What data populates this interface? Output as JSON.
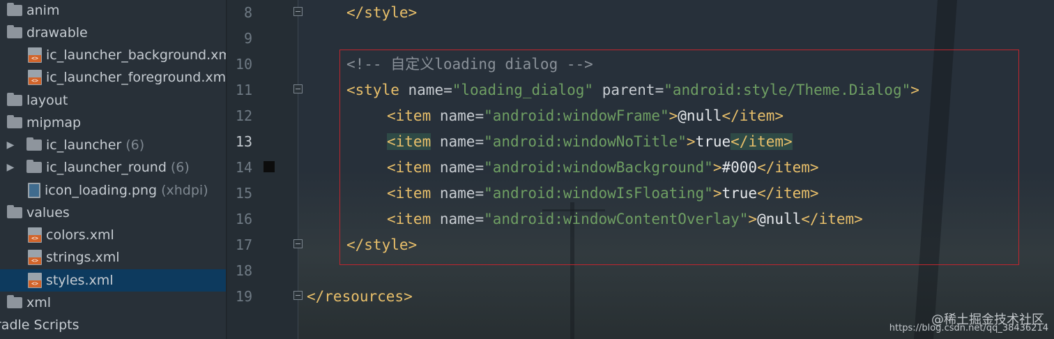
{
  "tree": {
    "items": [
      {
        "label": "anim",
        "type": "folder"
      },
      {
        "label": "drawable",
        "type": "folder"
      },
      {
        "label": "ic_launcher_background.xml",
        "type": "xml"
      },
      {
        "label": "ic_launcher_foreground.xml",
        "type": "xml"
      },
      {
        "label": "layout",
        "type": "folder"
      },
      {
        "label": "mipmap",
        "type": "folder"
      },
      {
        "label": "ic_launcher",
        "suffix": "(6)",
        "type": "folder"
      },
      {
        "label": "ic_launcher_round",
        "suffix": "(6)",
        "type": "folder"
      },
      {
        "label": "icon_loading.png",
        "suffix": "(xhdpi)",
        "type": "image"
      },
      {
        "label": "values",
        "type": "folder"
      },
      {
        "label": "colors.xml",
        "type": "xml"
      },
      {
        "label": "strings.xml",
        "type": "xml"
      },
      {
        "label": "styles.xml",
        "type": "xml",
        "selected": true
      },
      {
        "label": "xml",
        "type": "folder"
      },
      {
        "label": "radle Scripts",
        "type": "group"
      }
    ]
  },
  "editor": {
    "line_numbers": [
      "8",
      "9",
      "10",
      "11",
      "12",
      "13",
      "14",
      "15",
      "16",
      "17",
      "18",
      "19"
    ],
    "current_line": "13",
    "lines": {
      "l8": {
        "open": "</style>"
      },
      "l10": {
        "comment": "<!-- 自定义loading dialog -->"
      },
      "l11": {
        "open": "<style",
        "attr1": "name",
        "eq1": "=",
        "val1": "\"loading_dialog\"",
        "attr2": "parent",
        "eq2": "=",
        "val2": "\"android:style/Theme.Dialog\"",
        "close": ">"
      },
      "l12": {
        "open": "<item",
        "attr": "name",
        "eq": "=",
        "val": "\"android:windowFrame\"",
        "gt": ">",
        "text": "@null",
        "end": "</item>"
      },
      "l13": {
        "open": "<item",
        "attr": "name",
        "eq": "=",
        "val": "\"android:windowNoTitle\"",
        "gt": ">",
        "text": "true",
        "end": "</item>"
      },
      "l14": {
        "open": "<item",
        "attr": "name",
        "eq": "=",
        "val": "\"android:windowBackground\"",
        "gt": ">",
        "text": "#000",
        "end": "</item>"
      },
      "l15": {
        "open": "<item",
        "attr": "name",
        "eq": "=",
        "val": "\"android:windowIsFloating\"",
        "gt": ">",
        "text": "true",
        "end": "</item>"
      },
      "l16": {
        "open": "<item",
        "attr": "name",
        "eq": "=",
        "val": "\"android:windowContentOverlay\"",
        "gt": ">",
        "text": "@null",
        "end": "</item>"
      },
      "l17": {
        "open": "</style>"
      },
      "l19": {
        "open": "</resources>"
      }
    }
  },
  "watermark": {
    "line1": "@稀土掘金技术社区",
    "line2": "https://blog.csdn.net/qq_38436214"
  },
  "colors": {
    "tag": "#e8bf6a",
    "value": "#6f9f63",
    "comment": "#8a9199",
    "selection": "#0d3a5e",
    "annotation_box": "#c0262e"
  }
}
